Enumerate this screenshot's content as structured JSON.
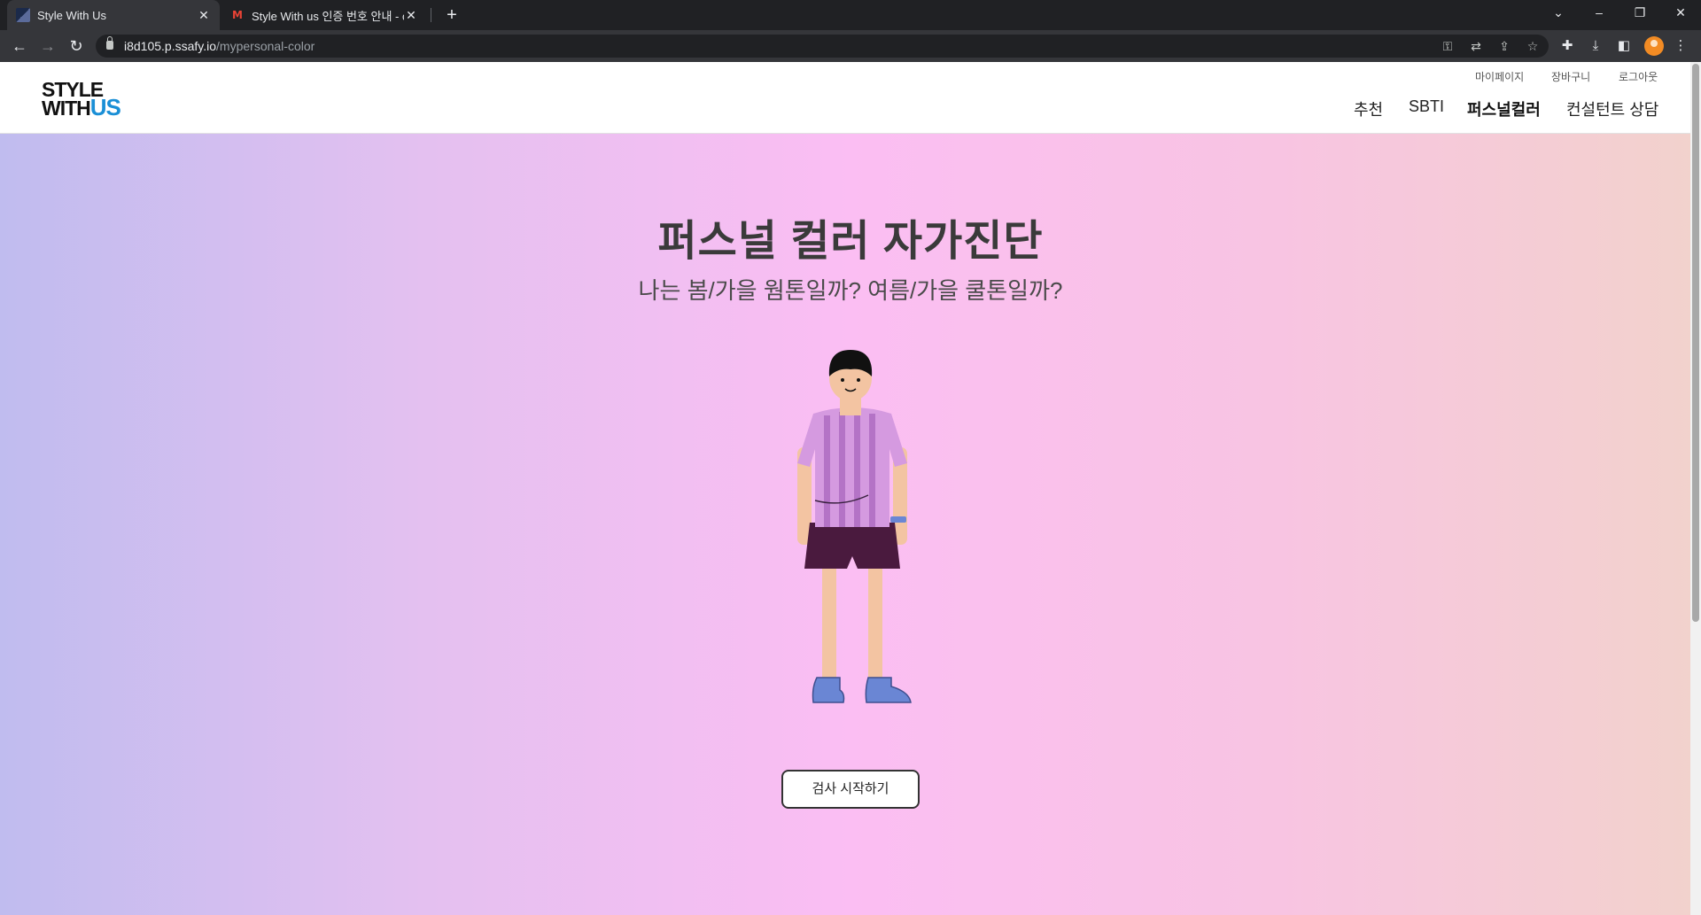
{
  "browser": {
    "tabs": [
      {
        "title": "Style With Us",
        "active": true,
        "icon": "site-favicon"
      },
      {
        "title": "Style With us 인증 번호 안내 - c",
        "active": false,
        "icon": "gmail-icon"
      }
    ],
    "address": {
      "host": "i8d105.p.ssafy.io",
      "path": "/mypersonal-color"
    }
  },
  "header": {
    "logo": {
      "line1": "STYLE",
      "line2": "WITH",
      "accent": "US",
      "accent_color": "#1a8fd6"
    },
    "util_links": [
      "마이페이지",
      "장바구니",
      "로그아웃"
    ],
    "nav": [
      {
        "label": "추천",
        "active": false
      },
      {
        "label": "SBTI",
        "active": false
      },
      {
        "label": "퍼스널컬러",
        "active": true
      },
      {
        "label": "컨설턴트 상담",
        "active": false
      }
    ]
  },
  "hero": {
    "title": "퍼스널 컬러 자가진단",
    "subtitle": "나는 봄/가을 웜톤일까? 여름/가을 쿨톤일까?",
    "illustration": "person-illustration",
    "start_button": "검사 시작하기"
  },
  "colors": {
    "gradient": [
      "#c0bcef",
      "#e4c0f0",
      "#fbbef3",
      "#f8c4e2",
      "#f2d2cc"
    ],
    "shirt": "#d59ae0",
    "shorts": "#4a1a3e",
    "shoes": "#6a86d4"
  }
}
